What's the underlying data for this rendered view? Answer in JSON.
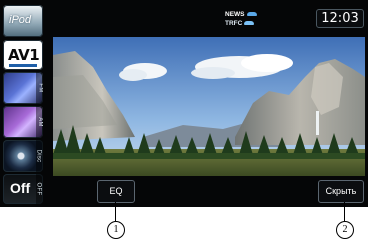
{
  "sources": [
    {
      "id": "ipod",
      "label": "iPod"
    },
    {
      "id": "av1",
      "label": "AV1"
    },
    {
      "id": "fm",
      "label": "FM"
    },
    {
      "id": "am",
      "label": "AM"
    },
    {
      "id": "disc",
      "label": "Disc"
    },
    {
      "id": "off",
      "label": "Off",
      "side_label": "OFF"
    }
  ],
  "status": {
    "news_label": "NEWS",
    "trfc_label": "TRFC",
    "time": "12:03"
  },
  "buttons": {
    "eq_label": "EQ",
    "hide_label": "Скрыть"
  },
  "callouts": {
    "one": "1",
    "two": "2"
  },
  "colors": {
    "screen_bg": "#050607",
    "button_border": "#5b6670",
    "accent_blue": "#1f5fa8"
  }
}
